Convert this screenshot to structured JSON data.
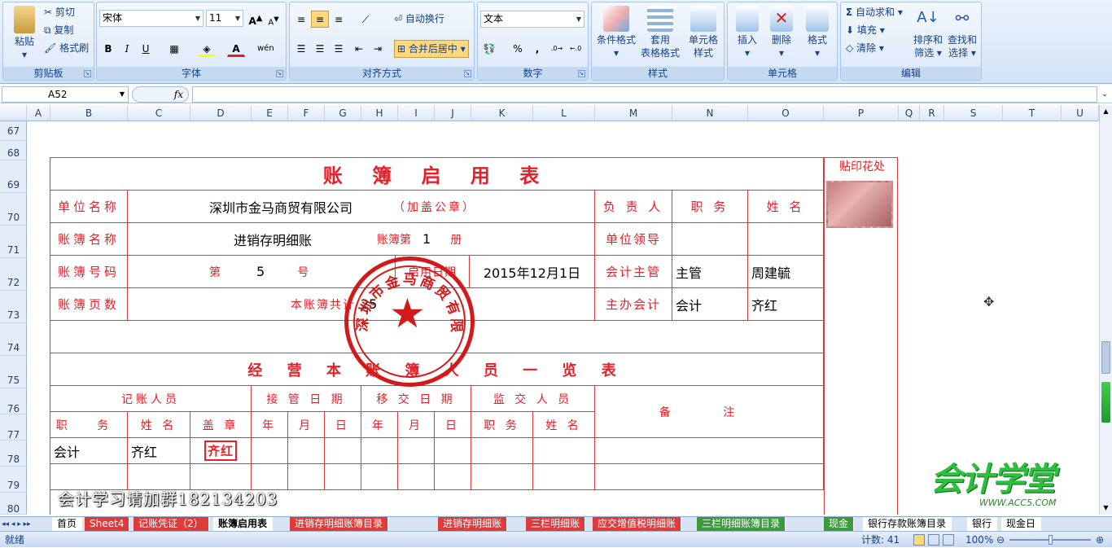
{
  "clipboard": {
    "paste": "粘贴",
    "cut": "剪切",
    "copy": "复制",
    "format_painter": "格式刷",
    "group": "剪贴板"
  },
  "font": {
    "family": "宋体",
    "size": "11",
    "group": "字体",
    "bold": "B",
    "italic": "I",
    "underline": "U",
    "color_a": "A",
    "phonetic": "wén"
  },
  "alignment": {
    "wrap": "自动换行",
    "merge": "合并后居中",
    "group": "对齐方式"
  },
  "number": {
    "format": "文本",
    "percent": "%",
    "comma": ",",
    "group": "数字"
  },
  "styles": {
    "cond": "条件格式",
    "table1": "套用",
    "table2": "表格格式",
    "cell1": "单元格",
    "cell2": "样式",
    "group": "样式"
  },
  "cells": {
    "insert": "插入",
    "delete": "删除",
    "format": "格式",
    "group": "单元格"
  },
  "editing": {
    "autosum": "自动求和",
    "fill": "填充",
    "clear": "清除",
    "sort1": "排序和",
    "sort2": "筛选",
    "find1": "查找和",
    "find2": "选择",
    "group": "编辑"
  },
  "formula_bar": {
    "name_box": "A52",
    "fx": "fx",
    "formula": ""
  },
  "columns": [
    "A",
    "B",
    "C",
    "D",
    "E",
    "F",
    "G",
    "H",
    "I",
    "J",
    "K",
    "L",
    "M",
    "N",
    "O",
    "P",
    "Q",
    "R",
    "S",
    "T",
    "U"
  ],
  "rows": [
    "67",
    "68",
    "69",
    "70",
    "71",
    "72",
    "73",
    "74",
    "75",
    "76",
    "77",
    "78",
    "79",
    "80"
  ],
  "ledger": {
    "title": "账 簿 启 用 表",
    "stamp_place": "贴印花处",
    "unit_name_label": "单位名称",
    "unit_name": "深圳市金马商贸有限公司",
    "seal_note": "（加盖公章）",
    "resp_label": "负 责 人",
    "position_label": "职 务",
    "name_label": "姓 名",
    "book_name_label": "账簿名称",
    "book_name": "进销存明细账",
    "vol_label": "账簿第",
    "vol_num": "1",
    "vol_unit": "册",
    "unit_leader": "单位领导",
    "book_no_label": "账簿号码",
    "no_prefix": "第",
    "no_num": "5",
    "no_suffix": "号",
    "start_label": "启用日期",
    "start_date": "2015年12月1日",
    "chief_acct": "会计主管",
    "chief_pos": "主管",
    "chief_name": "周建毓",
    "pages_label": "账簿页数",
    "pages_text": "本账簿共计",
    "pages_num": "25",
    "main_acct": "主办会计",
    "main_pos": "会计",
    "main_name": "齐红",
    "staff_title": "经 营 本 账 簿 人 员 一 览 表",
    "bookkeeper": "记账人员",
    "take_date": "接 管 日 期",
    "hand_date": "移 交 日 期",
    "supervisor": "监 交 人 员",
    "remark": "备 注",
    "col_pos": "职 务",
    "col_name": "姓 名",
    "col_seal": "盖 章",
    "year": "年",
    "month": "月",
    "day": "日",
    "row_pos": "会计",
    "row_name": "齐红",
    "row_seal": "齐红",
    "stamp_text": "深圳市金马商贸有限公司"
  },
  "watermark": {
    "group_text": "会计学习请加群182134203",
    "brand": "会计学堂",
    "url": "WWW.ACC5.COM"
  },
  "sheet_tabs": [
    "首页",
    "Sheet4",
    "记账凭证（2）",
    "账簿启用表",
    "进销存明细账簿目录",
    "进销存明细账",
    "三栏明细账",
    "应交增值税明细账",
    "三栏明细账簿目录",
    "现金",
    "银行存款账簿目录",
    "银行",
    "现金日"
  ],
  "active_tab": "账簿启用表",
  "status": {
    "ready": "就绪",
    "count": "计数: 41",
    "zoom": "100%"
  },
  "colors": {
    "ribbon": "#dbe8f8",
    "red": "#e23a3a",
    "tab_red": "#e03b3b",
    "tab_green": "#3c9a3c"
  }
}
